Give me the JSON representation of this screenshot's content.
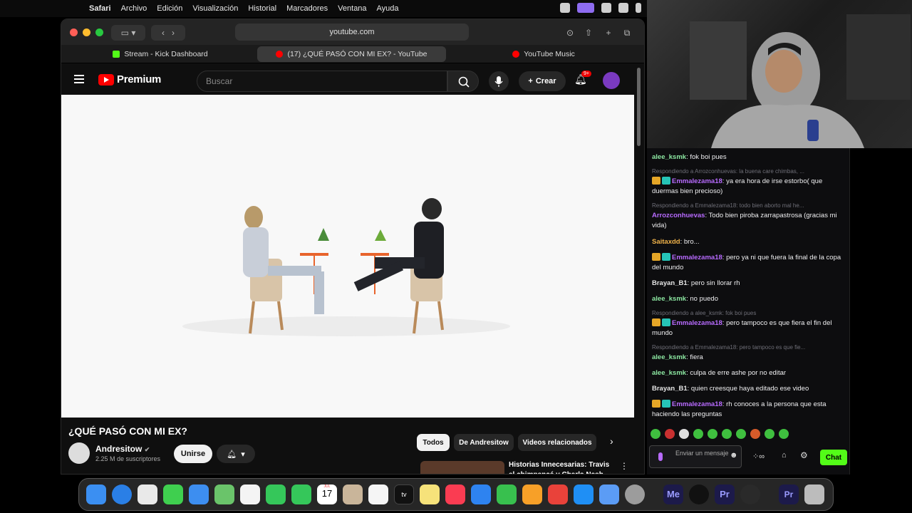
{
  "menubar": {
    "app": "Safari",
    "items": [
      "Archivo",
      "Edición",
      "Visualización",
      "Historial",
      "Marcadores",
      "Ventana",
      "Ayuda"
    ]
  },
  "browser": {
    "url": "youtube.com",
    "tabs": [
      {
        "label": "Stream - Kick Dashboard",
        "favicon_color": "#53fc18"
      },
      {
        "label": "(17) ¿QUÉ PASÓ CON MI EX? - YouTube",
        "favicon_color": "#ff0000"
      },
      {
        "label": "YouTube Music",
        "favicon_color": "#ff0000"
      }
    ]
  },
  "youtube": {
    "logo_text": "Premium",
    "search_placeholder": "Buscar",
    "create_label": "Crear",
    "notification_count": "9+",
    "video_title": "¿QUÉ PASÓ CON MI EX?",
    "channel_name": "Andresitow",
    "subscribers": "2.25 M de suscriptores",
    "join_label": "Unirse",
    "chips": [
      "Todos",
      "De Andresitow",
      "Videos relacionados"
    ],
    "related_title": "Historias Innecesarias: Travis el chimpancé y Charla Nash"
  },
  "chat": {
    "messages": [
      {
        "user": "alee_ksmk",
        "color": "green",
        "badges": [],
        "text": "fok boi pues"
      },
      {
        "reply": "Respondiendo a Arrozconhuevas: la buena care chimbas, ..."
      },
      {
        "user": "Emmalezama18",
        "color": "purple",
        "badges": [
          "crown",
          "sub"
        ],
        "text": "ya era hora de irse estorbo( que duermas bien precioso)"
      },
      {
        "reply": "Respondiendo a Emmalezama18: todo bien aborto mal he..."
      },
      {
        "user": "Arrozconhuevas",
        "color": "purple",
        "badges": [],
        "text": "Todo bien piroba zarrapastrosa (gracias mi vida)"
      },
      {
        "user": "Saitaxdd",
        "color": "orange",
        "badges": [],
        "text": "bro..."
      },
      {
        "user": "Emmalezama18",
        "color": "purple",
        "badges": [
          "crown",
          "sub"
        ],
        "text": "pero ya ni que fuera la final de la copa del mundo"
      },
      {
        "user": "Brayan_B1",
        "color": "white",
        "badges": [],
        "text": "pero sin llorar rh"
      },
      {
        "user": "alee_ksmk",
        "color": "green",
        "badges": [],
        "text": "no puedo"
      },
      {
        "reply": "Respondiendo a alee_ksmk: fok boi pues"
      },
      {
        "user": "Emmalezama18",
        "color": "purple",
        "badges": [
          "crown",
          "sub"
        ],
        "text": "pero tampoco es que fiera el fin del mundo"
      },
      {
        "reply": "Respondiendo a Emmalezama18: pero tampoco es que fie..."
      },
      {
        "user": "alee_ksmk",
        "color": "green",
        "badges": [],
        "text": "fiera"
      },
      {
        "user": "alee_ksmk",
        "color": "green",
        "badges": [],
        "text": "culpa de erre ashe por no editar"
      },
      {
        "user": "Brayan_B1",
        "color": "white",
        "badges": [],
        "text": "quien creesque haya editado ese video"
      },
      {
        "user": "Emmalezama18",
        "color": "purple",
        "badges": [
          "crown",
          "sub"
        ],
        "text": "rh conoces a la persona que esta haciendo las preguntas"
      }
    ],
    "input_placeholder": "Enviar un mensaje",
    "send_label": "Chat"
  },
  "dock": {
    "calendar_month": "JUL",
    "calendar_day": "17",
    "apps": [
      "finder-icon",
      "safari-icon",
      "launchpad-icon",
      "messages-icon",
      "mail-icon",
      "maps-icon",
      "photos-icon",
      "facetime-icon",
      "phone-icon",
      "calendar-icon",
      "contacts-icon",
      "reminders-icon",
      "appletv-icon",
      "notes-icon",
      "music-icon",
      "keynote-icon",
      "numbers-icon",
      "pages-icon",
      "rocket-icon",
      "appstore-icon",
      "iphone-mirroring-icon",
      "settings-icon",
      "media-encoder-icon",
      "capcut-icon",
      "premiere-icon",
      "obs-icon",
      "premiere-pro-icon",
      "trash-icon"
    ]
  }
}
